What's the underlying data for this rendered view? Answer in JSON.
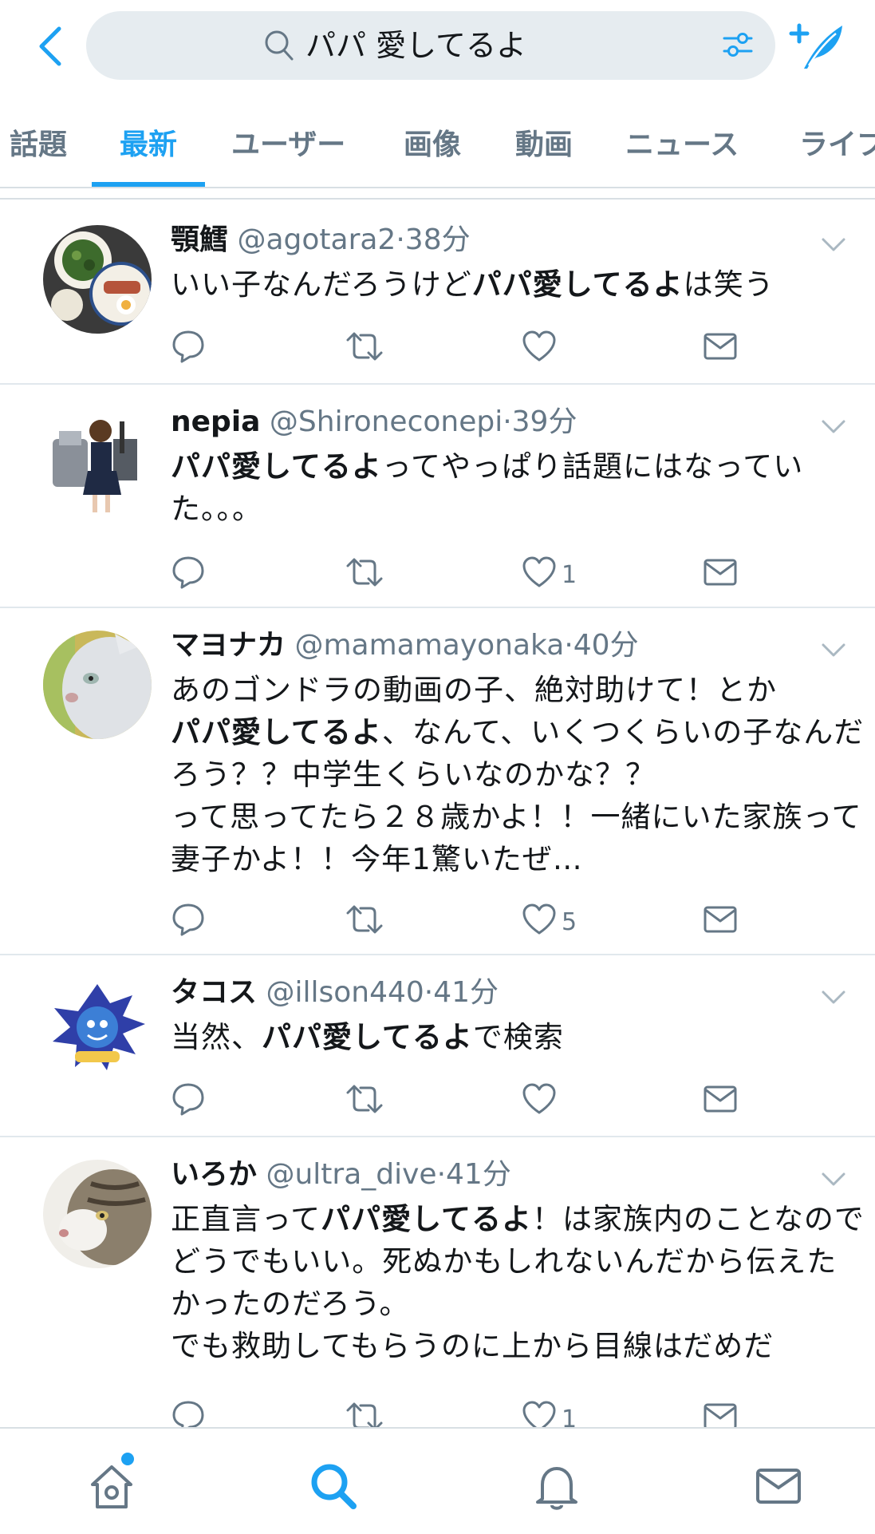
{
  "search": {
    "query": "パパ 愛してるよ"
  },
  "tabs": [
    {
      "label": "話題",
      "active": false
    },
    {
      "label": "最新",
      "active": true
    },
    {
      "label": "ユーザー",
      "active": false
    },
    {
      "label": "画像",
      "active": false
    },
    {
      "label": "動画",
      "active": false
    },
    {
      "label": "ニュース",
      "active": false
    },
    {
      "label": "ライブ",
      "active": false
    }
  ],
  "tweets": [
    {
      "name": "顎鱈",
      "handle": "@agotara2",
      "time": "38分",
      "text": [
        {
          "t": "いい子なんだろうけど"
        },
        {
          "t": "パパ愛してるよ",
          "b": true
        },
        {
          "t": "は笑う"
        }
      ],
      "likes": "",
      "avatar": "food-photo-avatar"
    },
    {
      "name": "nepia",
      "handle": "@Shironeconepi",
      "time": "39分",
      "text": [
        {
          "t": "パパ愛してるよ",
          "b": true
        },
        {
          "t": "ってやっぱり話題にはなっていた。。。"
        }
      ],
      "likes": "1",
      "avatar": "anime-character-avatar"
    },
    {
      "name": "マヨナカ",
      "handle": "@mamamayonaka",
      "time": "40分",
      "text": [
        {
          "t": "あのゴンドラの動画の子、絶対助けて！とか\n"
        },
        {
          "t": "パパ愛してるよ",
          "b": true
        },
        {
          "t": "、なんて、いくつくらいの子なんだろう？？中学生くらいなのかな？？\nって思ってたら２８歳かよ！！一緒にいた家族って妻子かよ！！今年1驚いたぜ…"
        }
      ],
      "likes": "5",
      "avatar": "white-cat-avatar"
    },
    {
      "name": "タコス",
      "handle": "@illson440",
      "time": "41分",
      "text": [
        {
          "t": "当然、"
        },
        {
          "t": "パパ愛してるよ",
          "b": true
        },
        {
          "t": "で検索"
        }
      ],
      "likes": "",
      "avatar": "blue-monster-avatar"
    },
    {
      "name": "いろか",
      "handle": "@ultra_dive",
      "time": "41分",
      "text": [
        {
          "t": "正直言って"
        },
        {
          "t": "パパ愛してるよ",
          "b": true
        },
        {
          "t": "！は家族内のことなのでどうでもいい。死ぬかもしれないんだから伝えたかったのだろう。\nでも救助してもらうのに上から目線はだめだ"
        }
      ],
      "likes": "1",
      "avatar": "tabby-cat-avatar"
    }
  ],
  "colors": {
    "accent": "#1da1f2",
    "muted": "#657786",
    "text": "#14171a",
    "searchBg": "#e6ecf0"
  }
}
